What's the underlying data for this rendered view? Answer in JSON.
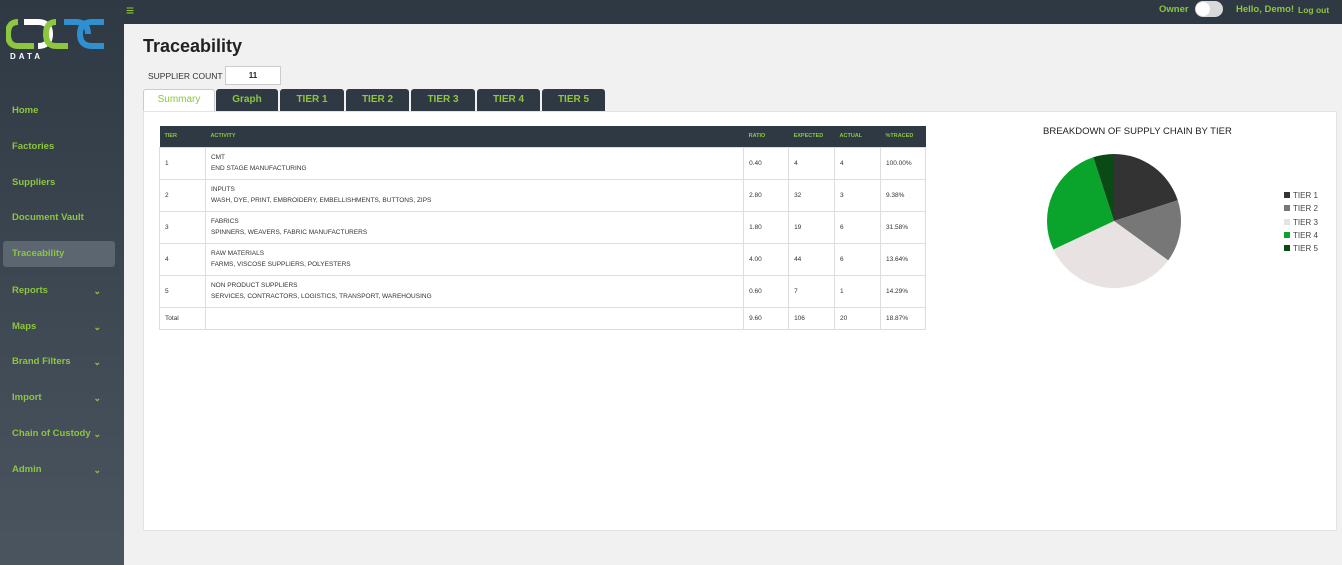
{
  "brand": {
    "logo_text": "DATA"
  },
  "topbar": {
    "owner_label": "Owner",
    "hello": "Hello, Demo!",
    "logout": "Log out"
  },
  "sidebar": {
    "items": [
      {
        "label": "Home",
        "has_chevron": false
      },
      {
        "label": "Factories",
        "has_chevron": false
      },
      {
        "label": "Suppliers",
        "has_chevron": false
      },
      {
        "label": "Document Vault",
        "has_chevron": false
      },
      {
        "label": "Traceability",
        "has_chevron": false,
        "active": true
      },
      {
        "label": "Reports",
        "has_chevron": true
      },
      {
        "label": "Maps",
        "has_chevron": true
      },
      {
        "label": "Brand Filters",
        "has_chevron": true
      },
      {
        "label": "Import",
        "has_chevron": true
      },
      {
        "label": "Chain of Custody",
        "has_chevron": true
      },
      {
        "label": "Admin",
        "has_chevron": true
      }
    ]
  },
  "main": {
    "title": "Traceability",
    "supplier_count_label": "SUPPLIER COUNT",
    "supplier_count_value": "11",
    "tabs": [
      "Summary",
      "Graph",
      "TIER 1",
      "TIER 2",
      "TIER 3",
      "TIER 4",
      "TIER 5"
    ],
    "active_tab": "Summary"
  },
  "table": {
    "headers": [
      "TIER",
      "ACTIVITY",
      "RATIO",
      "EXPECTED",
      "ACTUAL",
      "%TRACED"
    ],
    "rows": [
      {
        "tier": "1",
        "activity": "CMT",
        "detail": "END STAGE MANUFACTURING",
        "ratio": "0.40",
        "expected": "4",
        "actual": "4",
        "traced": "100.00%"
      },
      {
        "tier": "2",
        "activity": "INPUTS",
        "detail": "WASH, DYE, PRINT, EMBROIDERY, EMBELLISHMENTS, BUTTONS, ZIPS",
        "ratio": "2.80",
        "expected": "32",
        "actual": "3",
        "traced": "9.38%"
      },
      {
        "tier": "3",
        "activity": "FABRICS",
        "detail": "SPINNERS, WEAVERS, FABRIC MANUFACTURERS",
        "ratio": "1.80",
        "expected": "19",
        "actual": "6",
        "traced": "31.58%"
      },
      {
        "tier": "4",
        "activity": "RAW MATERIALS",
        "detail": "FARMS, VISCOSE SUPPLIERS, POLYESTERS",
        "ratio": "4.00",
        "expected": "44",
        "actual": "6",
        "traced": "13.64%"
      },
      {
        "tier": "5",
        "activity": "NON PRODUCT SUPPLIERS",
        "detail": "SERVICES, CONTRACTORS, LOGISTICS, TRANSPORT, WAREHOUSING",
        "ratio": "0.60",
        "expected": "7",
        "actual": "1",
        "traced": "14.29%"
      }
    ],
    "total": {
      "label": "Total",
      "ratio": "9.60",
      "expected": "106",
      "actual": "20",
      "traced": "18.87%"
    }
  },
  "chart_data": {
    "type": "pie",
    "title": "BREAKDOWN OF SUPPLY CHAIN BY TIER",
    "categories": [
      "TIER 1",
      "TIER 2",
      "TIER 3",
      "TIER 4",
      "TIER 5"
    ],
    "values": [
      20,
      15,
      33,
      27,
      5
    ],
    "colors": [
      "#333333",
      "#777777",
      "#e8e2e2",
      "#0aa32c",
      "#0a4a14"
    ],
    "legend_position": "right"
  },
  "colors": {
    "accent": "#8dc63f",
    "dark": "#2f3943"
  }
}
